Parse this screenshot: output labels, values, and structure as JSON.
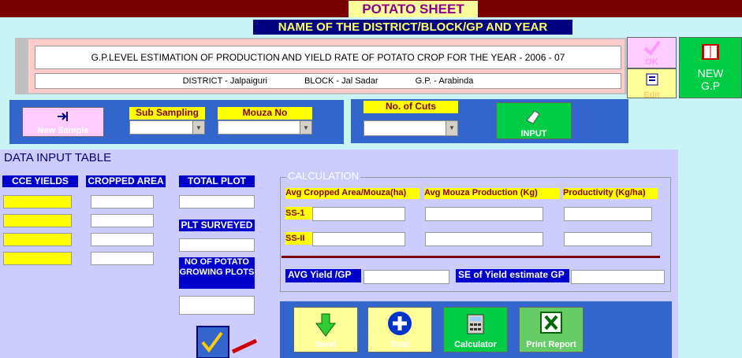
{
  "window": {
    "title": "POTATO SHEET",
    "subtitle": "NAME OF THE DISTRICT/BLOCK/GP AND YEAR"
  },
  "header": {
    "line1": "G.P.LEVEL ESTIMATION OF PRODUCTION AND YIELD RATE OF POTATO CROP FOR THE YEAR - 2006 - 07",
    "district": "DISTRICT - Jalpaiguri",
    "block": "BLOCK - Jal Sadar",
    "gp": "G.P. - Arabinda"
  },
  "buttons": {
    "ok": "OK",
    "edit": "Edit",
    "new_gp": "NEW G.P",
    "new_sample": "New Sample",
    "input": "INPUT",
    "send": "Send",
    "total": "Total",
    "calculator": "Calculator",
    "print_report": "Print Report"
  },
  "sampling": {
    "sub_sampling": "Sub Sampling",
    "mouza_no": "Mouza No",
    "no_of_cuts": "No. of Cuts"
  },
  "table": {
    "heading": "DATA INPUT TABLE",
    "cce_yields": "CCE YIELDS",
    "cropped_area": "CROPPED AREA",
    "total_plot": "TOTAL PLOT",
    "plt_surveyed": "PLT SURVEYED",
    "growing_plots": "NO OF POTATO GROWING PLOTS"
  },
  "calc": {
    "title": "CALCULATION",
    "avg_cropped": "Avg Cropped Area/Mouza(ha)",
    "avg_mouza": "Avg Mouza Production (Kg)",
    "productivity": "Productivity (Kg/ha)",
    "ss1": "SS-1",
    "ss2": "SS-II",
    "avg_yield": "AVG  Yield /GP",
    "se_yield": "SE of Yield estimate GP"
  }
}
